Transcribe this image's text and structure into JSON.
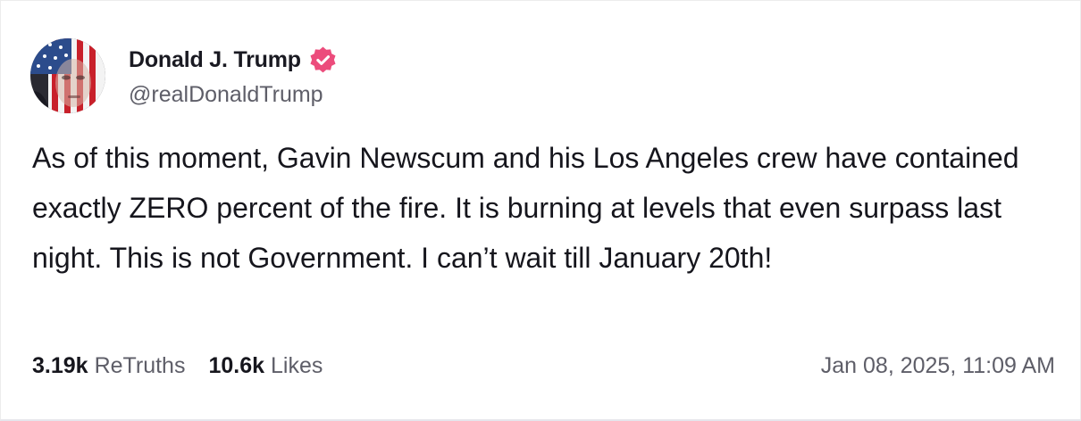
{
  "author": {
    "display_name": "Donald J. Trump",
    "handle": "@realDonaldTrump",
    "verified_icon": "verified-badge-icon",
    "verified_color": "#ec4c7c"
  },
  "post": {
    "text": "As of this moment, Gavin Newscum and his Los Angeles crew have contained exactly ZERO percent of the fire. It is burning at levels that even surpass last night. This is not Government. I can’t wait till January 20th!"
  },
  "stats": {
    "retruths_count": "3.19k",
    "retruths_label": "ReTruths",
    "likes_count": "10.6k",
    "likes_label": "Likes"
  },
  "timestamp": "Jan 08, 2025, 11:09 AM"
}
